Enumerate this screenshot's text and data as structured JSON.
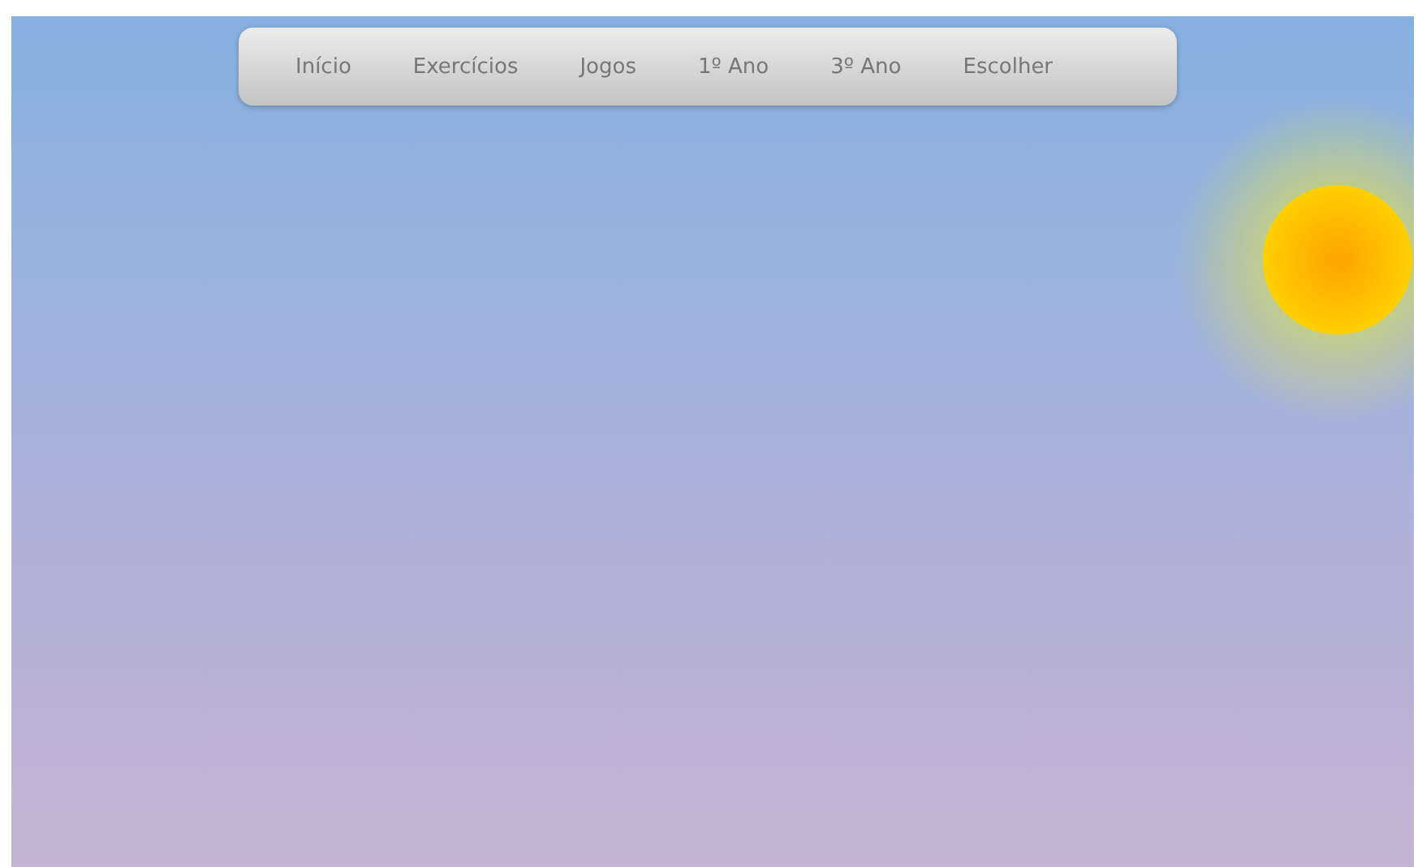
{
  "nav": {
    "items": [
      {
        "label": "Início"
      },
      {
        "label": "Exercícios"
      },
      {
        "label": "Jogos"
      },
      {
        "label": "1º Ano"
      },
      {
        "label": "3º Ano"
      },
      {
        "label": "Escolher"
      }
    ]
  }
}
